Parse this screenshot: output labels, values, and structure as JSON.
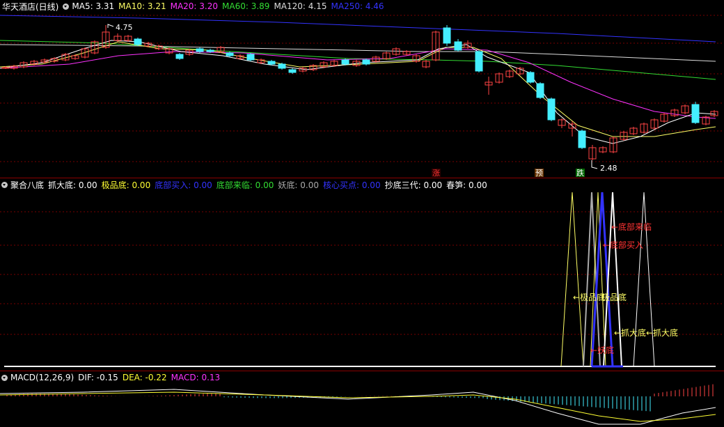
{
  "main": {
    "title": "华天酒店(日线)",
    "legend": [
      {
        "label": "MA5:",
        "value": "3.31",
        "color": "#ffffff"
      },
      {
        "label": "MA10:",
        "value": "3.21",
        "color": "#ffff66"
      },
      {
        "label": "MA20:",
        "value": "3.20",
        "color": "#ff33ff"
      },
      {
        "label": "MA60:",
        "value": "3.89",
        "color": "#33dd33"
      },
      {
        "label": "MA120:",
        "value": "4.15",
        "color": "#dddddd"
      },
      {
        "label": "MA250:",
        "value": "4.46",
        "color": "#3333ff"
      }
    ],
    "high_mark": "4.75",
    "low_mark": "2.48",
    "signals": [
      "涨",
      "预",
      "跌"
    ]
  },
  "indicator": {
    "name": "聚合八底",
    "legend": [
      {
        "label": "抓大底:",
        "value": "0.00",
        "color": "#ffffff"
      },
      {
        "label": "极品底:",
        "value": "0.00",
        "color": "#ffff33"
      },
      {
        "label": "底部买入:",
        "value": "0.00",
        "color": "#3333ff"
      },
      {
        "label": "底部来临:",
        "value": "0.00",
        "color": "#33dd33"
      },
      {
        "label": "妖底:",
        "value": "0.00",
        "color": "#aaaaaa"
      },
      {
        "label": "核心买点:",
        "value": "0.00",
        "color": "#3333ff"
      },
      {
        "label": "抄底三代:",
        "value": "0.00",
        "color": "#ffffff"
      },
      {
        "label": "春笋:",
        "value": "0.00",
        "color": "#ffffff"
      }
    ],
    "annotations": [
      {
        "text": "←底部来临",
        "color": "#ff3333"
      },
      {
        "text": "←底部买入",
        "color": "#ff3333"
      },
      {
        "text": "←极品底",
        "color": "#ffff66"
      },
      {
        "text": "极品底",
        "color": "#ffff66"
      },
      {
        "text": "←抓大底",
        "color": "#ffff66"
      },
      {
        "text": "←抓大底",
        "color": "#ffff66"
      },
      {
        "text": "←妖底",
        "color": "#ff3333"
      }
    ]
  },
  "macd": {
    "name": "MACD(12,26,9)",
    "legend": [
      {
        "label": "DIF:",
        "value": "-0.15",
        "color": "#ffffff"
      },
      {
        "label": "DEA:",
        "value": "-0.22",
        "color": "#ffff33"
      },
      {
        "label": "MACD:",
        "value": "0.13",
        "color": "#ff33ff"
      }
    ]
  }
}
